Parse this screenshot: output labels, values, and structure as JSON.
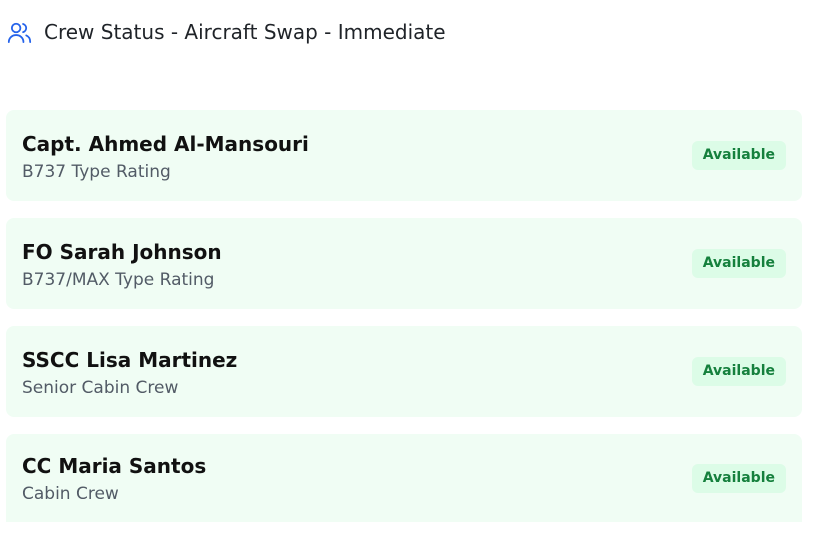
{
  "header": {
    "title": "Crew Status - Aircraft Swap - Immediate",
    "icon": "users-icon",
    "icon_color": "#2563eb"
  },
  "crew": [
    {
      "name": "Capt. Ahmed Al-Mansouri",
      "role": "B737 Type Rating",
      "status": "Available"
    },
    {
      "name": "FO Sarah Johnson",
      "role": "B737/MAX Type Rating",
      "status": "Available"
    },
    {
      "name": "SSCC Lisa Martinez",
      "role": "Senior Cabin Crew",
      "status": "Available"
    },
    {
      "name": "CC Maria Santos",
      "role": "Cabin Crew",
      "status": "Available"
    }
  ],
  "colors": {
    "card_background": "#f0fdf4",
    "badge_background": "#dcfce7",
    "badge_text": "#15803d"
  }
}
